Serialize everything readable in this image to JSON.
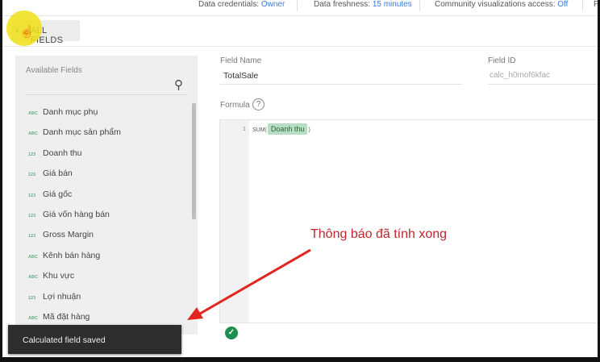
{
  "topbar": {
    "credentials_label": "Data credentials:",
    "credentials_value": "Owner",
    "freshness_label": "Data freshness:",
    "freshness_value": "15 minutes",
    "community_label": "Community visualizations access:",
    "community_value": "Off",
    "cut_label": "F"
  },
  "back_button": {
    "label": "ALL FIELDS"
  },
  "panel": {
    "title": "Available Fields",
    "fields": [
      {
        "type": "ABC",
        "name": "Danh mục phụ"
      },
      {
        "type": "ABC",
        "name": "Danh mục sản phẩm"
      },
      {
        "type": "123",
        "name": "Doanh thu"
      },
      {
        "type": "123",
        "name": "Giá bán"
      },
      {
        "type": "123",
        "name": "Giá gốc"
      },
      {
        "type": "123",
        "name": "Giá vốn hàng bán"
      },
      {
        "type": "123",
        "name": "Gross Margin"
      },
      {
        "type": "ABC",
        "name": "Kênh bán hàng"
      },
      {
        "type": "ABC",
        "name": "Khu vực"
      },
      {
        "type": "123",
        "name": "Lợi nhuận"
      },
      {
        "type": "ABC",
        "name": "Mã đặt hàng"
      }
    ]
  },
  "form": {
    "field_name_label": "Field Name",
    "field_name_value": "TotalSale",
    "field_id_label": "Field ID",
    "field_id_value": "calc_h0mof6kfac",
    "formula_label": "Formula",
    "help": "?",
    "line_number": "1",
    "func_open": "SUM(",
    "chip": "Doanh thu",
    "func_close": ")"
  },
  "toast": {
    "message": "Calculated field saved"
  },
  "annotation": {
    "text": "Thông báo đã tính xong",
    "color": "#c0262d"
  }
}
